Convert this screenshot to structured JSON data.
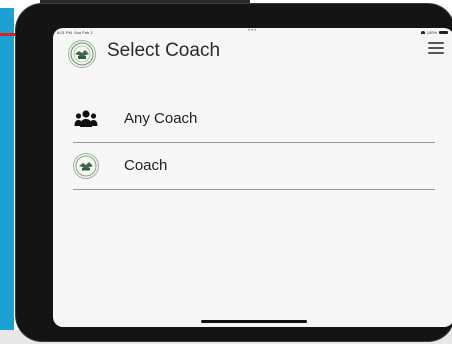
{
  "status_bar": {
    "time": "8:01 PM",
    "date": "Sun Feb 2",
    "battery": "100%"
  },
  "header": {
    "title": "Select Coach",
    "logo_icon": "club-crest-icon",
    "menu_icon": "hamburger-menu-icon"
  },
  "coaches": {
    "items": [
      {
        "label": "Any Coach",
        "icon": "group-users-icon"
      },
      {
        "label": "Coach",
        "icon": "club-crest-icon"
      }
    ]
  },
  "colors": {
    "screen_bg": "#f6f6f6",
    "device_frame": "#141414",
    "divider": "#9a9a9a",
    "text": "#222222"
  }
}
